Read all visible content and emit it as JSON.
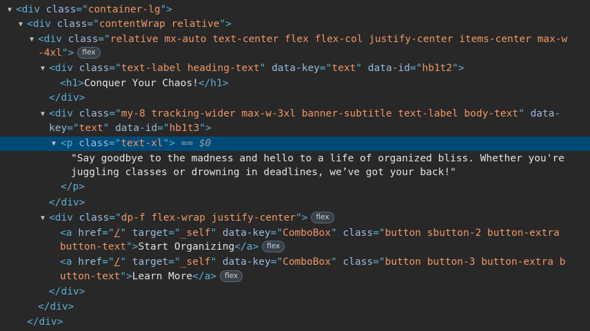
{
  "nodes": {
    "n1": {
      "tag": "div",
      "attrs": [
        {
          "name": "class",
          "value": "container-lg"
        }
      ]
    },
    "n2": {
      "tag": "div",
      "attrs": [
        {
          "name": "class",
          "value": "contentWrap relative"
        }
      ]
    },
    "n3": {
      "tag": "div",
      "attr_name": "class",
      "value_part1": "relative mx-auto text-center flex flex-col justify-center items-center max-w",
      "value_part2": "-4xl",
      "badge": "flex"
    },
    "n4": {
      "tag": "div",
      "attrs": [
        {
          "name": "class",
          "value": "text-label heading-text"
        },
        {
          "name": "data-key",
          "value": "text"
        },
        {
          "name": "data-id",
          "value": "hb1t2"
        }
      ]
    },
    "n5": {
      "tag": "h1",
      "text": "Conquer Your Chaos!"
    },
    "n4_close": "div",
    "n6": {
      "tag": "div",
      "attr_name": "class",
      "value": "my-8 tracking-wider max-w-3xl banner-subtitle text-label body-text",
      "attr2_part1": "data-",
      "attr2_part2": "key",
      "attr2_value": "text",
      "attr3_name": "data-id",
      "attr3_value": "hb1t3"
    },
    "n7": {
      "tag": "p",
      "attr_name": "class",
      "attr_value": "text-xl",
      "marker": "== $0"
    },
    "n7_text_line1": "\"Say goodbye to the madness and hello to a life of organized bliss. Whether you're",
    "n7_text_line2": "juggling classes or drowning in deadlines, we’ve got your back!\"",
    "n7_close": "p",
    "n6_close": "div",
    "n8": {
      "tag": "div",
      "attr_name": "class",
      "attr_value": "dp-f flex-wrap justify-center",
      "badge": "flex"
    },
    "a1": {
      "tag": "a",
      "href": "/",
      "target": "_self",
      "data_key": "ComboBox",
      "class_part1": "button sbutton-2 button-extra",
      "class_part2": "button-text",
      "text": "Start Organizing",
      "badge": "flex"
    },
    "a2": {
      "tag": "a",
      "href": "/",
      "target": "_self",
      "data_key": "ComboBox",
      "class_part1": "button button-3 button-extra b",
      "class_part2": "utton-text",
      "text": "Learn More",
      "badge": "flex"
    },
    "n8_close": "div",
    "n3_close": "div",
    "n2_close": "div"
  },
  "labels": {
    "a_href": "href",
    "a_target": "target",
    "a_data_key": "data-key",
    "a_class": "class"
  }
}
